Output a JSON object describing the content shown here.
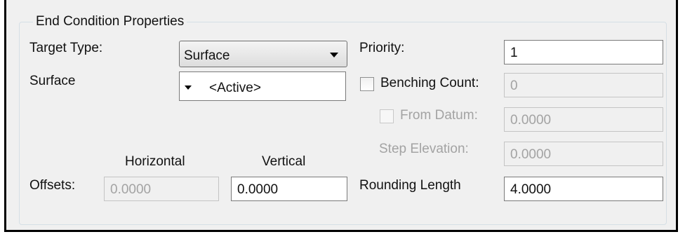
{
  "group": {
    "title": "End Condition Properties"
  },
  "target_type": {
    "label": "Target Type:",
    "value": "Surface"
  },
  "surface": {
    "label": "Surface",
    "value": "<Active>"
  },
  "priority": {
    "label": "Priority:",
    "value": "1"
  },
  "benching_count": {
    "label": "Benching Count:",
    "value": "0",
    "checked": false
  },
  "from_datum": {
    "label": "From Datum:",
    "value": "0.0000",
    "checked": false
  },
  "step_elevation": {
    "label": "Step Elevation:",
    "value": "0.0000"
  },
  "offsets": {
    "label": "Offsets:",
    "horizontal_header": "Horizontal",
    "vertical_header": "Vertical",
    "horizontal_value": "0.0000",
    "vertical_value": "0.0000"
  },
  "rounding_length": {
    "label": "Rounding Length",
    "value": "4.0000"
  }
}
